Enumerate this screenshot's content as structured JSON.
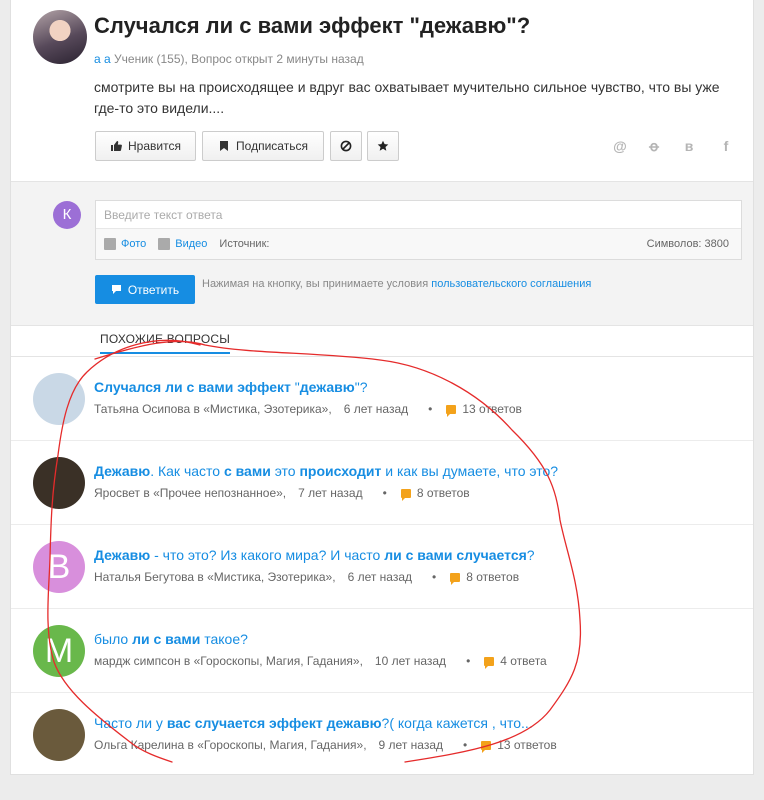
{
  "question": {
    "title": "Случался ли с вами эффект \"дежавю\"?",
    "author": "а а",
    "meta": "Ученик (155), Вопрос открыт 2 минуты назад",
    "text": "смотрите вы на происходящее и вдруг вас охватывает мучительно сильное чувство, что вы уже где-то это видели...."
  },
  "actions": {
    "like_label": "Нравится",
    "subscribe_label": "Подписаться"
  },
  "share_icons": [
    "at-icon",
    "odnoklassniki-icon",
    "vk-icon",
    "facebook-icon"
  ],
  "share_glyphs": {
    "at": "@",
    "ok": "ꝋ",
    "vk": "в",
    "fb": "f"
  },
  "answer": {
    "user_initial": "К",
    "placeholder": "Введите текст ответа",
    "photo_label": "Фото",
    "video_label": "Видео",
    "source_label": "Источник:",
    "counter": "Символов: 3800",
    "submit_label": "Ответить",
    "terms_prefix": "Нажимая на кнопку, вы принимаете условия",
    "terms_link": "пользовательского соглашения"
  },
  "similar": {
    "tab_label": "ПОХОЖИЕ ВОПРОСЫ",
    "items": [
      {
        "q": [
          {
            "t": "Случался ли с вами эффект ",
            "b": true
          },
          {
            "t": "\"",
            "b": false
          },
          {
            "t": "дежавю",
            "b": true
          },
          {
            "t": "\"?",
            "b": false
          }
        ],
        "author": "Татьяна Осипова в «Мистика, Эзотерика»,",
        "time": "6 лет назад",
        "answers": "13 ответов",
        "avatar_letter": "",
        "avatar_color": "#c9d8e6"
      },
      {
        "q": [
          {
            "t": "Дежавю",
            "b": true
          },
          {
            "t": ". Как часто ",
            "b": false
          },
          {
            "t": "с вами",
            "b": true
          },
          {
            "t": " это ",
            "b": false
          },
          {
            "t": "происходит",
            "b": true
          },
          {
            "t": " и как вы думаете, что это?",
            "b": false
          }
        ],
        "author": "Яросвет в «Прочее непознанное»,",
        "time": "7 лет назад",
        "answers": "8 ответов",
        "avatar_letter": "",
        "avatar_color": "#3a3026"
      },
      {
        "q": [
          {
            "t": "Дежавю",
            "b": true
          },
          {
            "t": " - что это? Из какого мира? И часто ",
            "b": false
          },
          {
            "t": "ли с вами случается",
            "b": true
          },
          {
            "t": "?",
            "b": false
          }
        ],
        "author": "Наталья Бегутова в «Мистика, Эзотерика»,",
        "time": "6 лет назад",
        "answers": "8 ответов",
        "avatar_letter": "В",
        "avatar_color": "#d88fdc"
      },
      {
        "q": [
          {
            "t": "было ",
            "b": false
          },
          {
            "t": "ли с вами",
            "b": true
          },
          {
            "t": " такое?",
            "b": false
          }
        ],
        "author": "мардж симпсон в «Гороскопы, Магия, Гадания»,",
        "time": "10 лет назад",
        "answers": "4 ответа",
        "avatar_letter": "М",
        "avatar_color": "#69b84b"
      },
      {
        "q": [
          {
            "t": "Часто ли у ",
            "b": false
          },
          {
            "t": "вас случается эффект дежавю",
            "b": true
          },
          {
            "t": "?( когда кажется , что...",
            "b": false
          }
        ],
        "author": "Ольга Карелина в «Гороскопы, Магия, Гадания»,",
        "time": "9 лет назад",
        "answers": "13 ответов",
        "avatar_letter": "",
        "avatar_color": "#6a5a3c"
      }
    ]
  },
  "colors": {
    "accent": "#168de2",
    "counter_icon": "#f3a21b",
    "annotation_stroke": "#e52b2b"
  }
}
